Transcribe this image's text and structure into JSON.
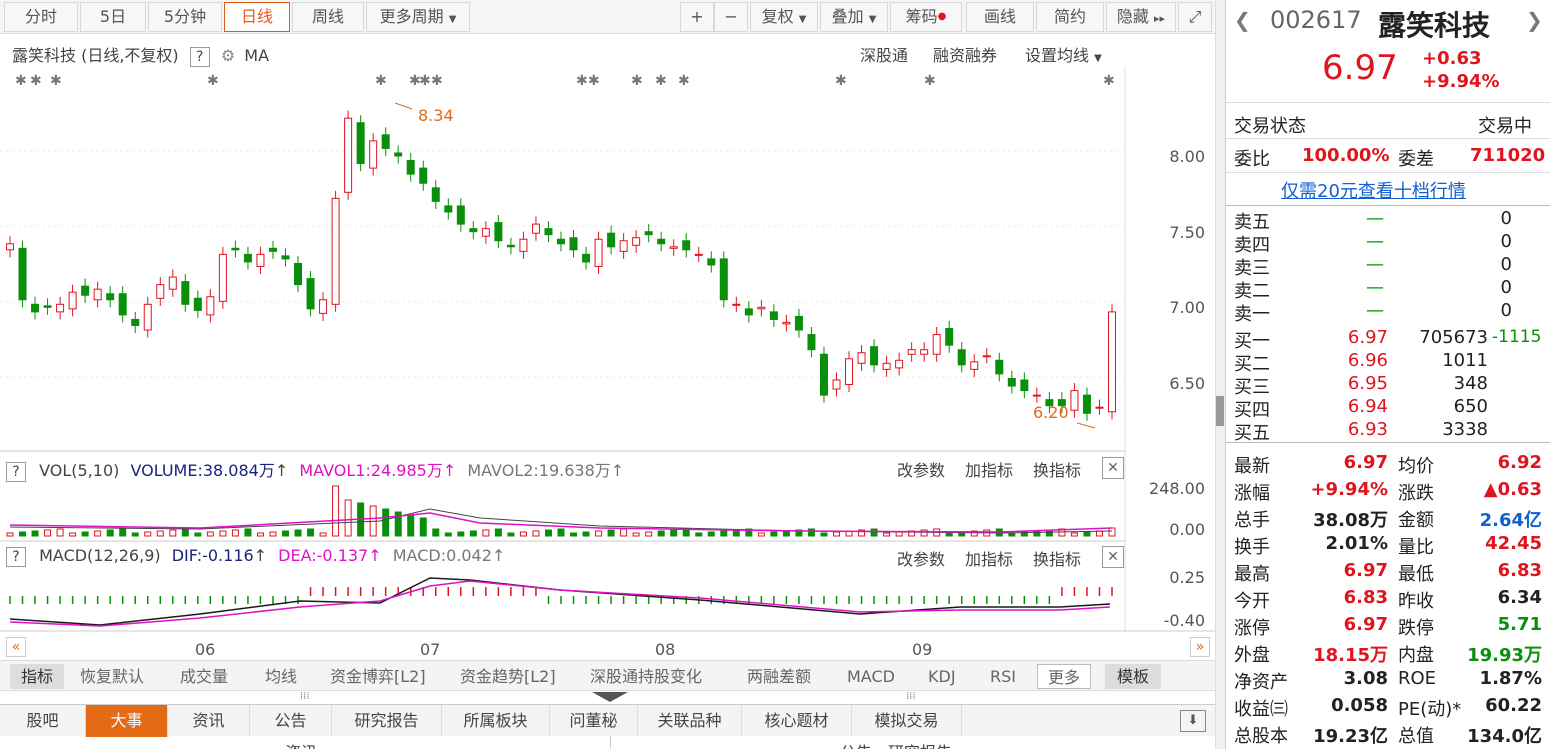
{
  "toolbar": {
    "periods": [
      "分时",
      "5日",
      "5分钟",
      "日线",
      "周线",
      "更多周期"
    ],
    "active_period": "日线",
    "tools": [
      "+",
      "−",
      "复权",
      "叠加",
      "筹码",
      "画线",
      "简约",
      "隐藏"
    ]
  },
  "kline": {
    "title": "露笑科技 (日线,不复权)",
    "help": "?",
    "indicator": "MA",
    "links": [
      "深股通",
      "融资融券",
      "设置均线"
    ],
    "high_label": "8.34",
    "low_label": "6.20",
    "y_ticks": [
      "8.00",
      "7.50",
      "7.00",
      "6.50"
    ]
  },
  "vol": {
    "help": "?",
    "name": "VOL(5,10)",
    "volume": "VOLUME:38.084万",
    "mavol1": "MAVOL1:24.985万",
    "mavol2": "MAVOL2:19.638万",
    "actions": [
      "改参数",
      "加指标",
      "换指标"
    ],
    "y_ticks": [
      "248.00",
      "0.00"
    ]
  },
  "macd": {
    "help": "?",
    "name": "MACD(12,26,9)",
    "dif": "DIF:-0.116",
    "dea": "DEA:-0.137",
    "macd": "MACD:0.042",
    "actions": [
      "改参数",
      "加指标",
      "换指标"
    ],
    "y_ticks": [
      "0.25",
      "-0.40"
    ]
  },
  "x_months": [
    "06",
    "07",
    "08",
    "09"
  ],
  "indicator_bar": [
    "指标",
    "恢复默认",
    "成交量",
    "均线",
    "资金博弈[L2]",
    "资金趋势[L2]",
    "深股通持股变化",
    "两融差额",
    "MACD",
    "KDJ",
    "RSI",
    "更多",
    "模板"
  ],
  "info_tabs": [
    "股吧",
    "大事",
    "资讯",
    "公告",
    "研究报告",
    "所属板块",
    "问董秘",
    "关联品种",
    "核心题材",
    "模拟交易"
  ],
  "info_active": "大事",
  "info_bottom": [
    "资讯",
    "公告、研究报告"
  ],
  "stock": {
    "code": "002617",
    "name": "露笑科技",
    "price": "6.97",
    "change": "+0.63",
    "change_pct": "+9.94%",
    "status_label": "交易状态",
    "status_value": "交易中",
    "weibi_label": "委比",
    "weibi_value": "100.00%",
    "weicha_label": "委差",
    "weicha_value": "711020",
    "promo": "仅需20元查看十档行情"
  },
  "asks": [
    {
      "label": "卖五",
      "price": "—",
      "vol": "0"
    },
    {
      "label": "卖四",
      "price": "—",
      "vol": "0"
    },
    {
      "label": "卖三",
      "price": "—",
      "vol": "0"
    },
    {
      "label": "卖二",
      "price": "—",
      "vol": "0"
    },
    {
      "label": "卖一",
      "price": "—",
      "vol": "0"
    }
  ],
  "bids": [
    {
      "label": "买一",
      "price": "6.97",
      "vol": "705673",
      "delta": "-1115"
    },
    {
      "label": "买二",
      "price": "6.96",
      "vol": "1011",
      "delta": ""
    },
    {
      "label": "买三",
      "price": "6.95",
      "vol": "348",
      "delta": ""
    },
    {
      "label": "买四",
      "price": "6.94",
      "vol": "650",
      "delta": ""
    },
    {
      "label": "买五",
      "price": "6.93",
      "vol": "3338",
      "delta": ""
    }
  ],
  "stats": [
    {
      "l1": "最新",
      "v1": "6.97",
      "c1": "red",
      "l2": "均价",
      "v2": "6.92",
      "c2": "red"
    },
    {
      "l1": "涨幅",
      "v1": "+9.94%",
      "c1": "red",
      "l2": "涨跌",
      "v2": "▲0.63",
      "c2": "red"
    },
    {
      "l1": "总手",
      "v1": "38.08万",
      "c1": "blk",
      "l2": "金额",
      "v2": "2.64亿",
      "c2": "blue"
    },
    {
      "l1": "换手",
      "v1": "2.01%",
      "c1": "blk",
      "l2": "量比",
      "v2": "42.45",
      "c2": "red"
    },
    {
      "l1": "最高",
      "v1": "6.97",
      "c1": "red",
      "l2": "最低",
      "v2": "6.83",
      "c2": "red"
    },
    {
      "l1": "今开",
      "v1": "6.83",
      "c1": "red",
      "l2": "昨收",
      "v2": "6.34",
      "c2": "blk"
    },
    {
      "l1": "涨停",
      "v1": "6.97",
      "c1": "red",
      "l2": "跌停",
      "v2": "5.71",
      "c2": "green"
    },
    {
      "l1": "外盘",
      "v1": "18.15万",
      "c1": "red",
      "l2": "内盘",
      "v2": "19.93万",
      "c2": "green"
    },
    {
      "l1": "净资产",
      "v1": "3.08",
      "c1": "blk",
      "l2": "ROE",
      "v2": "1.87%",
      "c2": "blk"
    },
    {
      "l1": "收益㈢",
      "v1": "0.058",
      "c1": "blk",
      "l2": "PE(动)*",
      "v2": "60.22",
      "c2": "blk"
    },
    {
      "l1": "总股本",
      "v1": "19.23亿",
      "c1": "blk",
      "l2": "总值",
      "v2": "134.0亿",
      "c2": "blk"
    }
  ],
  "colors": {
    "up": "#e0141e",
    "down": "#0a8f0a",
    "accent": "#e36b18",
    "pink": "#e010c8",
    "navy": "#1a237e"
  }
}
